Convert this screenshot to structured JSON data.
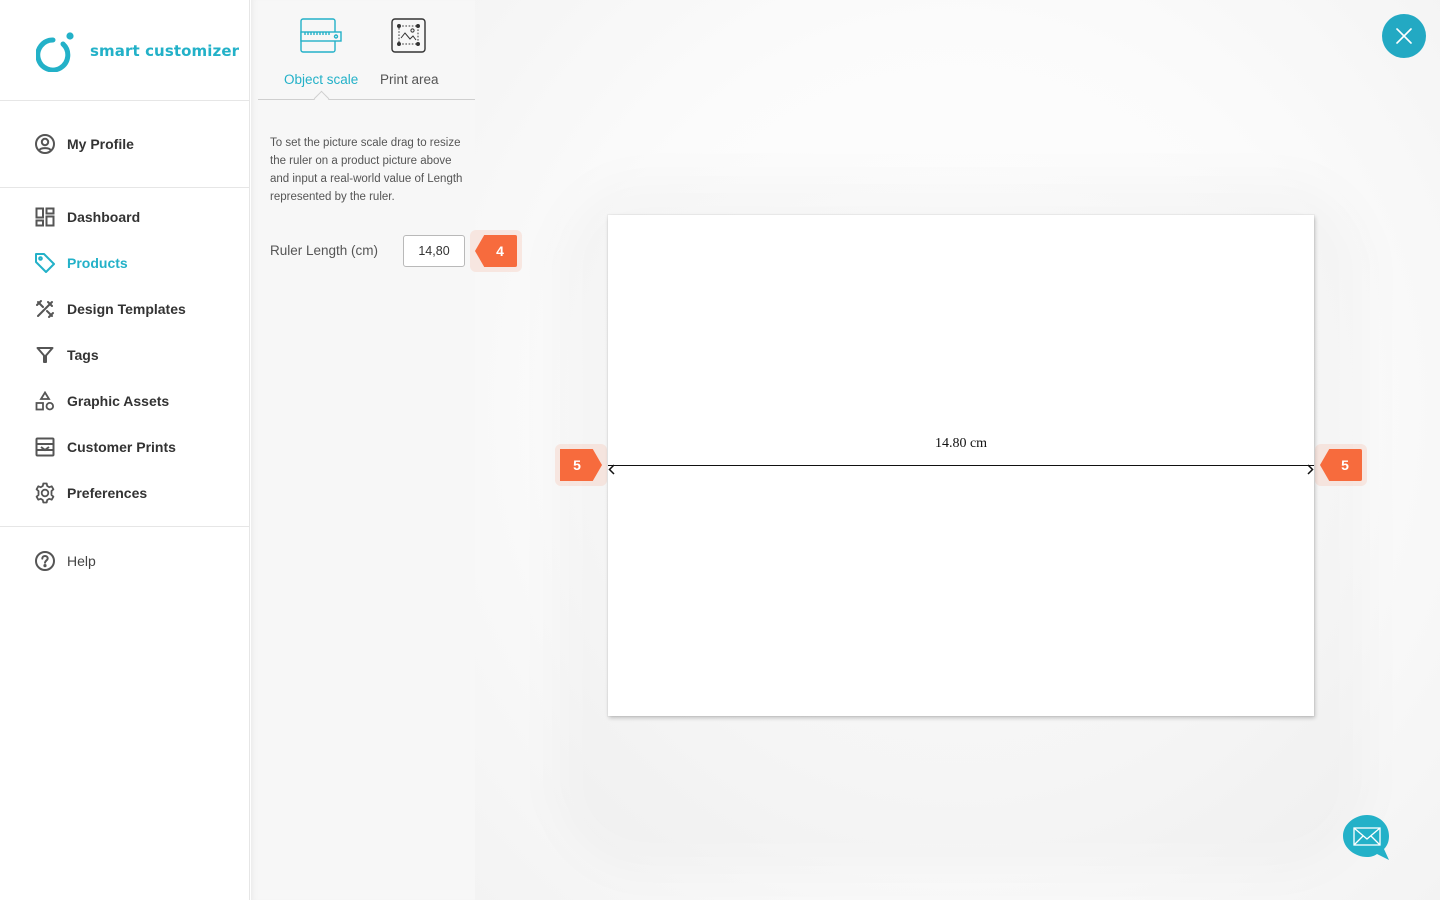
{
  "brand": {
    "name": "smart customizer",
    "accent_color": "#23b1c8",
    "badge_color": "#f76b3d"
  },
  "sidebar": {
    "profile": {
      "label": "My Profile",
      "icon": "user-circle-icon"
    },
    "items": [
      {
        "label": "Dashboard",
        "icon": "dashboard-icon",
        "active": false
      },
      {
        "label": "Products",
        "icon": "tag-icon",
        "active": true
      },
      {
        "label": "Design Templates",
        "icon": "design-tools-icon",
        "active": false
      },
      {
        "label": "Tags",
        "icon": "filter-icon",
        "active": false
      },
      {
        "label": "Graphic Assets",
        "icon": "shapes-icon",
        "active": false
      },
      {
        "label": "Customer Prints",
        "icon": "prints-icon",
        "active": false
      },
      {
        "label": "Preferences",
        "icon": "gear-icon",
        "active": false
      }
    ],
    "help": {
      "label": "Help",
      "icon": "help-circle-icon"
    }
  },
  "panel": {
    "tabs": [
      {
        "label": "Object scale",
        "icon": "ruler-icon",
        "active": true
      },
      {
        "label": "Print area",
        "icon": "image-select-icon",
        "active": false
      }
    ],
    "instructions": "To set the picture scale drag to resize the ruler on a product picture above and input a real-world value of Length represented by the ruler.",
    "ruler_length": {
      "label": "Ruler Length (cm)",
      "value": "14,80"
    }
  },
  "badges": {
    "ruler_input_step": "4",
    "ruler_left_step": "5",
    "ruler_right_step": "5"
  },
  "canvas": {
    "ruler_caption": "14.80 cm"
  },
  "buttons": {
    "close_icon": "close-icon",
    "chat_icon": "mail-chat-icon"
  }
}
